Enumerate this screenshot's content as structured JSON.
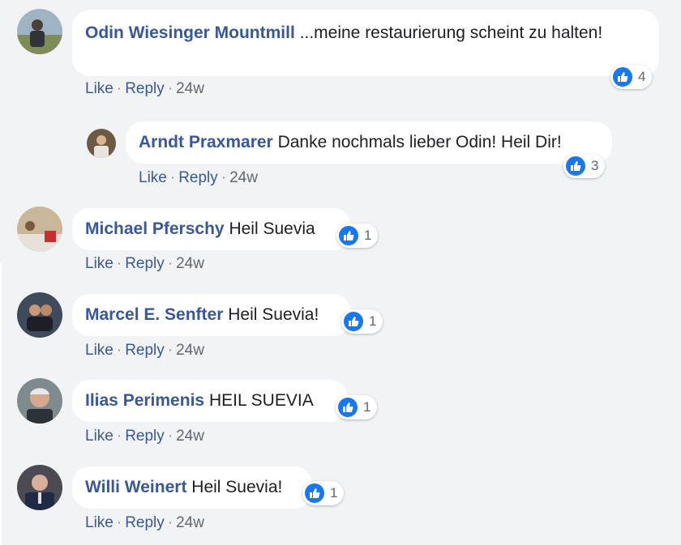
{
  "colors": {
    "background": "#f2f3f5",
    "bubble": "#ffffff",
    "author": "#385898",
    "like_blue": "#1877f2"
  },
  "action_labels": {
    "like": "Like",
    "reply": "Reply",
    "separator": "·"
  },
  "comments": [
    {
      "author": "Odin Wiesinger Mountmill",
      "text": "...meine restaurierung scheint zu halten!",
      "reactions": "4",
      "time": "24w",
      "avatar_icon": "user-avatar-icon"
    },
    {
      "author": "Arndt Praxmarer",
      "text": "Danke nochmals lieber Odin! Heil Dir!",
      "reactions": "3",
      "time": "24w",
      "avatar_icon": "user-avatar-icon"
    },
    {
      "author": "Michael Pferschy",
      "text": "Heil Suevia",
      "reactions": "1",
      "time": "24w",
      "avatar_icon": "user-avatar-icon"
    },
    {
      "author": "Marcel E. Senfter",
      "text": "Heil Suevia!",
      "reactions": "1",
      "time": "24w",
      "avatar_icon": "user-avatar-icon"
    },
    {
      "author": "Ilias Perimenis",
      "text": "HEIL SUEVIA",
      "reactions": "1",
      "time": "24w",
      "avatar_icon": "user-avatar-icon"
    },
    {
      "author": "Willi Weinert",
      "text": "Heil Suevia!",
      "reactions": "1",
      "time": "24w",
      "avatar_icon": "user-avatar-icon"
    }
  ]
}
